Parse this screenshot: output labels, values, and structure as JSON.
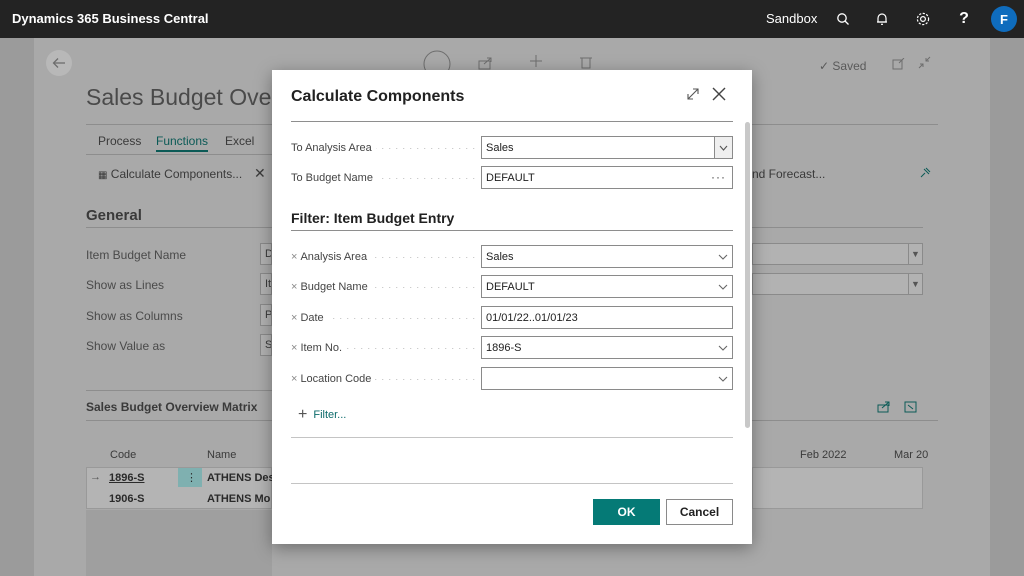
{
  "topbar": {
    "brand": "Dynamics 365 Business Central",
    "environment": "Sandbox",
    "avatar_initial": "F"
  },
  "background_page": {
    "title": "Sales Budget Over",
    "saved_status": "Saved",
    "tabs": [
      "Process",
      "Functions",
      "Excel"
    ],
    "active_tab": "Functions",
    "actions": {
      "calculate_components": "Calculate Components...",
      "forecast_partial": "nd Forecast..."
    },
    "general_section": "General",
    "general_fields": [
      {
        "label": "Item Budget Name",
        "value": "D"
      },
      {
        "label": "Show as Lines",
        "value": "It"
      },
      {
        "label": "Show as Columns",
        "value": "Pe"
      },
      {
        "label": "Show Value as",
        "value": "S"
      }
    ],
    "matrix_title": "Sales Budget Overview Matrix",
    "matrix_columns": {
      "code": "Code",
      "name": "Name",
      "feb": "Feb 2022",
      "mar": "Mar 20"
    },
    "matrix_rows": [
      {
        "code": "1896-S",
        "name": "ATHENS Des"
      },
      {
        "code": "1906-S",
        "name": "ATHENS Mo"
      }
    ]
  },
  "dialog": {
    "title": "Calculate Components",
    "to_analysis_area": {
      "label": "To Analysis Area",
      "value": "Sales"
    },
    "to_budget_name": {
      "label": "To Budget Name",
      "value": "DEFAULT"
    },
    "filter_section_title": "Filter: Item Budget Entry",
    "filters": [
      {
        "label": "Analysis Area",
        "value": "Sales"
      },
      {
        "label": "Budget Name",
        "value": "DEFAULT"
      },
      {
        "label": "Date",
        "value": "01/01/22..01/01/23"
      },
      {
        "label": "Item No.",
        "value": "1896-S"
      },
      {
        "label": "Location Code",
        "value": ""
      }
    ],
    "add_filter_label": "Filter...",
    "ok_label": "OK",
    "cancel_label": "Cancel"
  }
}
